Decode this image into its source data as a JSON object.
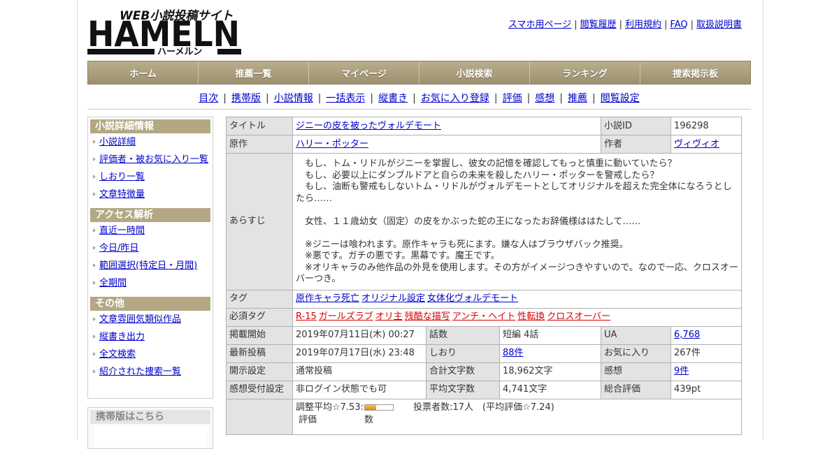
{
  "logo": {
    "tagline": "WEB小説投稿サイト",
    "name": "HAMELN",
    "kana": "ハーメルン"
  },
  "top_links": [
    "スマホ用ページ",
    "閲覧履歴",
    "利用規約",
    "FAQ",
    "取扱説明書"
  ],
  "main_nav": [
    "ホーム",
    "推薦一覧",
    "マイページ",
    "小説検索",
    "ランキング",
    "捜索掲示板"
  ],
  "sub_nav": [
    "目次",
    "携帯版",
    "小説情報",
    "一括表示",
    "縦書き",
    "お気に入り登録",
    "評価",
    "感想",
    "推薦",
    "閲覧設定"
  ],
  "sidebar": {
    "sections": [
      {
        "title": "小説詳細情報",
        "items": [
          "小説詳細",
          "評価者・被お気に入り一覧",
          "しおり一覧",
          "文章特徴量"
        ]
      },
      {
        "title": "アクセス解析",
        "items": [
          "直近一時間",
          "今日/昨日",
          "範囲選択(特定日・月間)",
          "全期間"
        ]
      },
      {
        "title": "その他",
        "items": [
          "文章雰囲気類似作品",
          "縦書き出力",
          "全文検索",
          "紹介された捜索一覧"
        ]
      }
    ],
    "mobile_title": "携帯版はこちら"
  },
  "info": {
    "title_label": "タイトル",
    "title": "ジニーの皮を被ったヴォルデモート",
    "id_label": "小説ID",
    "id": "196298",
    "original_label": "原作",
    "original": "ハリー・ポッター",
    "author_label": "作者",
    "author": "ヴィヴィオ",
    "synopsis_label": "あらすじ",
    "synopsis": "　もし、トム・リドルがジニーを掌握し、彼女の記憶を確認してもっと慎重に動いていたら？\n　もし、必要以上にダンブルドアと自らの未来を殺したハリー・ポッターを警戒したら？\n　もし、油断も警戒もしないトム・リドルがヴォルデモートとしてオリジナルを超えた完全体になろうとしたら……\n\n　女性、１１歳幼女（固定）の皮をかぶった蛇の王になったお辞儀様ははたして……\n\n　※ジニーは喰われます。原作キャラも死にます。嫌な人はブラウザバック推奨。\n　※悪です。ガチの悪です。黒幕です。魔王です。\n　※オリキャラのみ他作品の外見を使用します。その方がイメージつきやすいので。なので一応、クロスオーバーつき。",
    "tag_label": "タグ",
    "tags": [
      "原作キャラ死亡",
      "オリジナル設定",
      "女体化ヴォルデモート"
    ],
    "req_tag_label": "必須タグ",
    "req_tags": [
      "R-15",
      "ガールズラブ",
      "オリ主",
      "残酷な描写",
      "アンチ・ヘイト",
      "性転換",
      "クロスオーバー"
    ],
    "start_label": "掲載開始",
    "start": "2019年07月11日(木) 00:27",
    "episodes_label": "話数",
    "episodes": "短編 4話",
    "ua_label": "UA",
    "ua": "6,768",
    "latest_label": "最新投稿",
    "latest": "2019年07月17日(水) 23:48",
    "bookmark_label": "しおり",
    "bookmark": "88件",
    "fav_label": "お気に入り",
    "fav": "267件",
    "release_label": "開示設定",
    "release": "通常投稿",
    "chars_label": "合計文字数",
    "chars": "18,962文字",
    "comments_label": "感想",
    "comments": "9件",
    "accept_label": "感想受付設定",
    "accept": "非ログイン状態でも可",
    "avg_chars_label": "平均文字数",
    "avg_chars": "4,741文字",
    "total_eval_label": "総合評価",
    "total_eval": "439pt",
    "adjusted_label": "調整平均☆7.53:",
    "adjusted_fill": 0.4,
    "voters": "投票者数:17人　(平均評価☆7.24)",
    "col_eval": "評価",
    "col_count": "数"
  }
}
